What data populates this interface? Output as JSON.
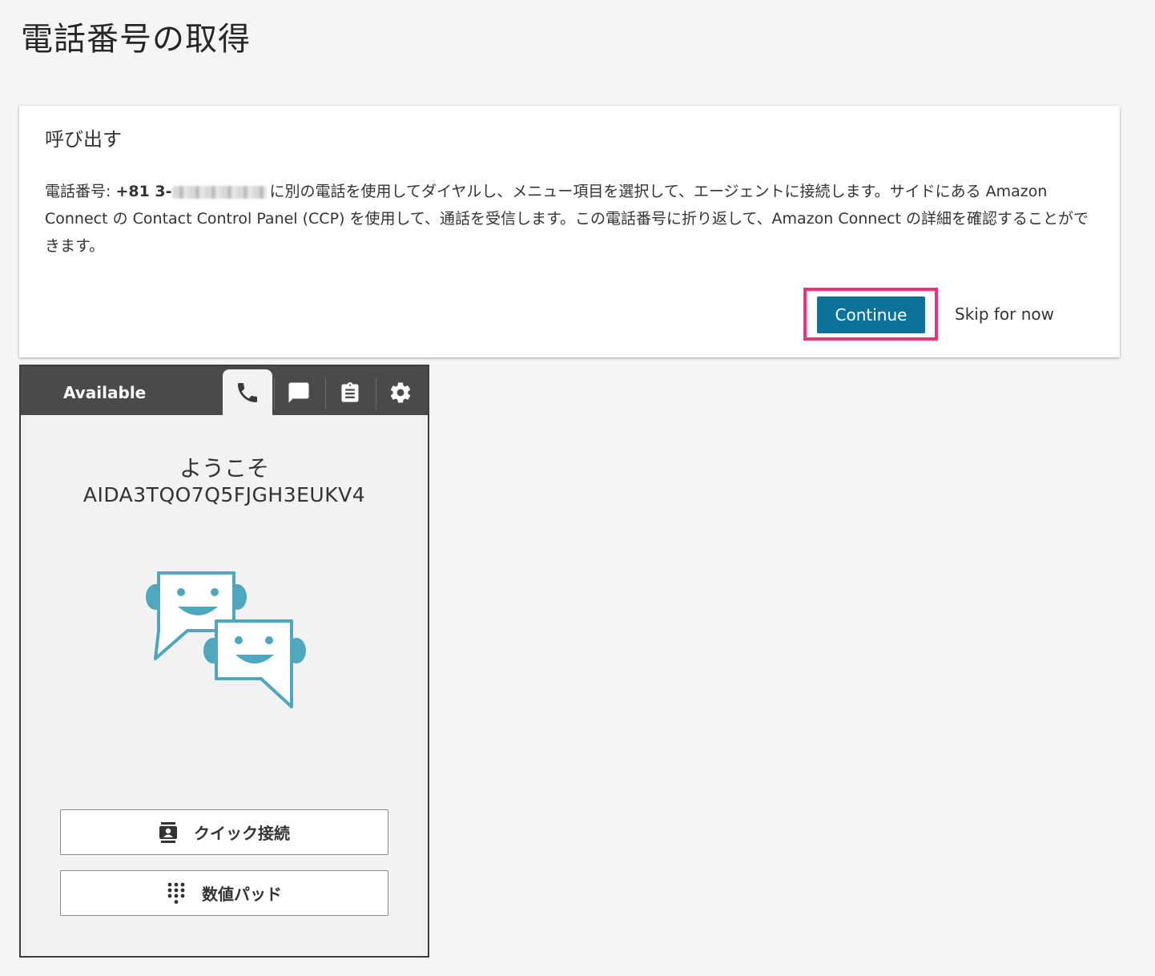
{
  "page": {
    "title": "電話番号の取得"
  },
  "dialog": {
    "heading": "呼び出す",
    "body_prefix": "電話番号: ",
    "phone_visible": "+81 3-",
    "body_text": "に別の電話を使用してダイヤルし、メニュー項目を選択して、エージェントに接続します。サイドにある Amazon Connect の Contact Control Panel (CCP) を使用して、通話を受信します。この電話番号に折り返して、Amazon Connect の詳細を確認することができます。",
    "continue_label": "Continue",
    "skip_label": "Skip for now",
    "highlight_color": "#f0317a",
    "primary_color": "#0b7299"
  },
  "ccp": {
    "status": "Available",
    "tabs": [
      {
        "icon": "phone-icon",
        "active": true
      },
      {
        "icon": "chat-icon",
        "active": false
      },
      {
        "icon": "clipboard-icon",
        "active": false
      },
      {
        "icon": "gear-icon",
        "active": false
      }
    ],
    "welcome": "ようこそ",
    "agent_id": "AIDA3TQO7Q5FJGH3EUKV4",
    "quick_connect_label": "クイック接続",
    "numpad_label": "数値パッド",
    "mascot_color": "#4fa6bf"
  }
}
